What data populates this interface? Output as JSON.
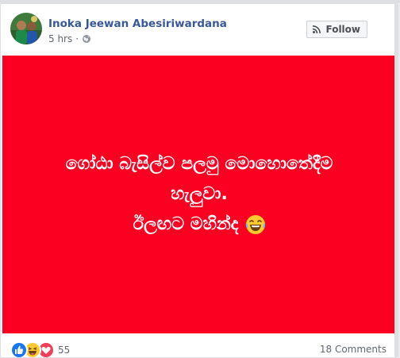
{
  "post": {
    "author": "Inoka Jeewan Abesiriwardana",
    "time": "5 hrs",
    "privacy_icon": "globe-icon",
    "follow_label": "Follow",
    "follow_icon": "rss-icon",
    "background_color": "#fb0020",
    "text_lines": [
      "ගෝඨා බැසිල්ව පලමු මොහොතේදීම",
      "හැලුවා.",
      "ඊලඟට මහින්ද"
    ],
    "text_emoji": "tears-of-joy-emoji",
    "reactions": {
      "icons": [
        "like-icon",
        "haha-icon",
        "love-icon"
      ],
      "count": "55"
    },
    "comments_label": "18 Comments"
  }
}
